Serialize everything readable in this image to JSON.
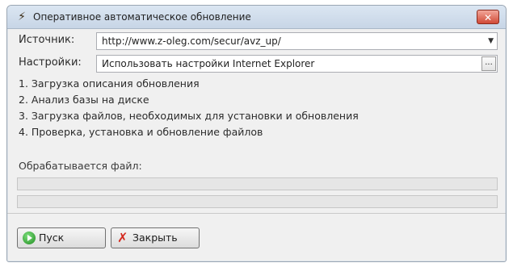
{
  "window": {
    "title": "Оперативное автоматическое обновление",
    "close_glyph": "✕"
  },
  "form": {
    "source_label": "Источник:",
    "source_value": "http://www.z-oleg.com/secur/avz_up/",
    "settings_label": "Настройки:",
    "settings_value": "Использовать настройки Internet Explorer",
    "settings_button": "..."
  },
  "steps": [
    "1. Загрузка описания обновления",
    "2. Анализ базы на диске",
    "3. Загрузка файлов, необходимых для установки и обновления",
    "4. Проверка, установка и обновление файлов"
  ],
  "status": {
    "processing_label": "Обрабатывается файл:",
    "progress_primary": 0,
    "progress_secondary": 0
  },
  "buttons": {
    "start_label": "Пуск",
    "close_label": "Закрыть"
  },
  "icons": {
    "app": "app-icon",
    "start": "play-circle-icon",
    "close": "red-x-icon",
    "dropdown": "chevron-down-icon"
  }
}
